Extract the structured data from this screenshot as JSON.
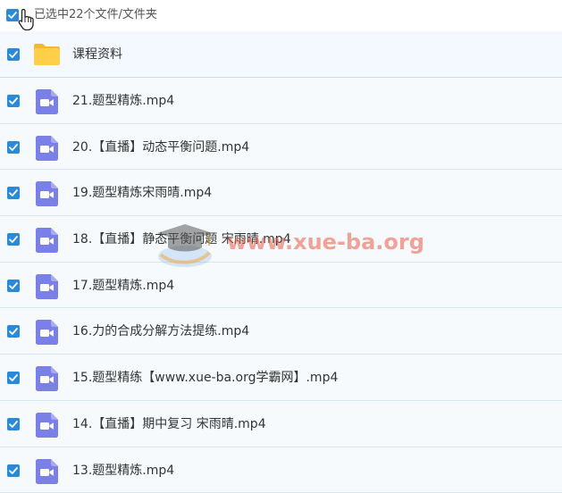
{
  "header": {
    "selected_label": "已选中22个文件/文件夹",
    "checked": true
  },
  "rows": [
    {
      "type": "folder",
      "name": "课程资料",
      "checked": true,
      "icon": "folder-icon"
    },
    {
      "type": "video",
      "name": "21.题型精炼.mp4",
      "checked": true,
      "icon": "video-file-icon"
    },
    {
      "type": "video",
      "name": "20.【直播】动态平衡问题.mp4",
      "checked": true,
      "icon": "video-file-icon"
    },
    {
      "type": "video",
      "name": "19.题型精炼宋雨晴.mp4",
      "checked": true,
      "icon": "video-file-icon"
    },
    {
      "type": "video",
      "name": "18.【直播】静态平衡问题 宋雨晴.mp4",
      "checked": true,
      "icon": "video-file-icon"
    },
    {
      "type": "video",
      "name": "17.题型精炼.mp4",
      "checked": true,
      "icon": "video-file-icon"
    },
    {
      "type": "video",
      "name": "16.力的合成分解方法提练.mp4",
      "checked": true,
      "icon": "video-file-icon"
    },
    {
      "type": "video",
      "name": "15.题型精练【www.xue-ba.org学霸网】.mp4",
      "checked": true,
      "icon": "video-file-icon"
    },
    {
      "type": "video",
      "name": "14.【直播】期中复习 宋雨晴.mp4",
      "checked": true,
      "icon": "video-file-icon"
    },
    {
      "type": "video",
      "name": "13.题型精炼.mp4",
      "checked": true,
      "icon": "video-file-icon"
    }
  ],
  "watermark": {
    "text": "www.xue-ba.org"
  },
  "colors": {
    "accent": "#2b8ad8",
    "row_bg": "#f6fafd",
    "divider": "#d6e6f5",
    "video_icon": "#7b7fe8",
    "folder_icon": "#ffc940"
  }
}
